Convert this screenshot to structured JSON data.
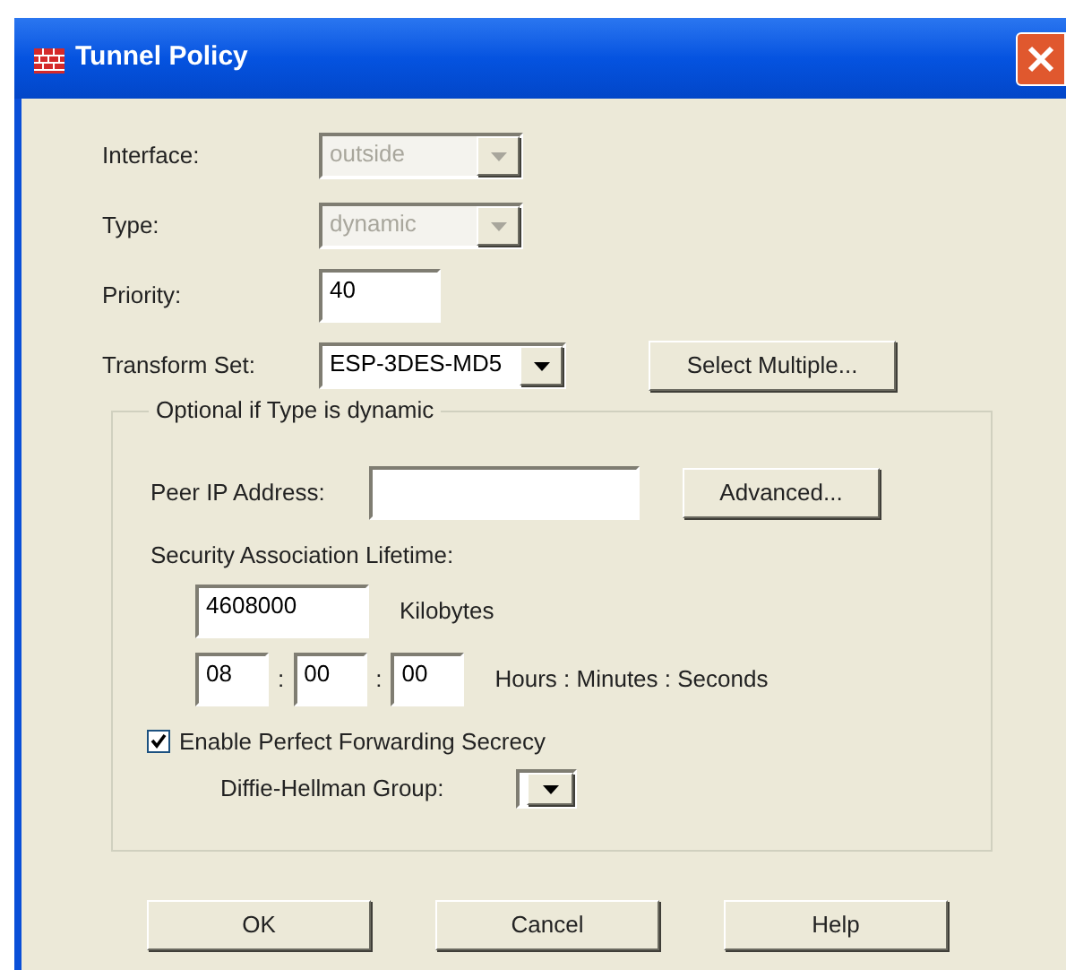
{
  "window": {
    "title": "Tunnel Policy"
  },
  "fields": [
    {
      "label": "Interface:",
      "kind": "dropdown",
      "value": "outside",
      "disabled": true
    },
    {
      "label": "Type:",
      "kind": "dropdown",
      "value": "dynamic",
      "disabled": true
    },
    {
      "label": "Priority:",
      "kind": "text",
      "value": "40",
      "disabled": false
    },
    {
      "label": "Transform Set:",
      "kind": "dropdown",
      "value": "ESP-3DES-MD5",
      "disabled": false
    }
  ],
  "select_multiple_button": "Select Multiple...",
  "optional_group": {
    "title": "Optional if Type is dynamic",
    "peer_ip": {
      "label": "Peer IP Address:"
    },
    "advanced_button": "Advanced...",
    "lifetime_label": "Security Association Lifetime:",
    "kilobytes": {
      "value": "4608000",
      "unit": "Kilobytes"
    },
    "time": {
      "hours": "08",
      "minutes": "00",
      "seconds": "00",
      "separator_1": ":",
      "separator_2": ":",
      "unit": "Hours : Minutes : Seconds"
    },
    "pfs": {
      "label": "Enable Perfect Forwarding Secrecy",
      "checked": true
    },
    "dh_group": {
      "label": "Diffie-Hellman Group:"
    }
  },
  "buttons": [
    "OK",
    "Cancel",
    "Help"
  ]
}
